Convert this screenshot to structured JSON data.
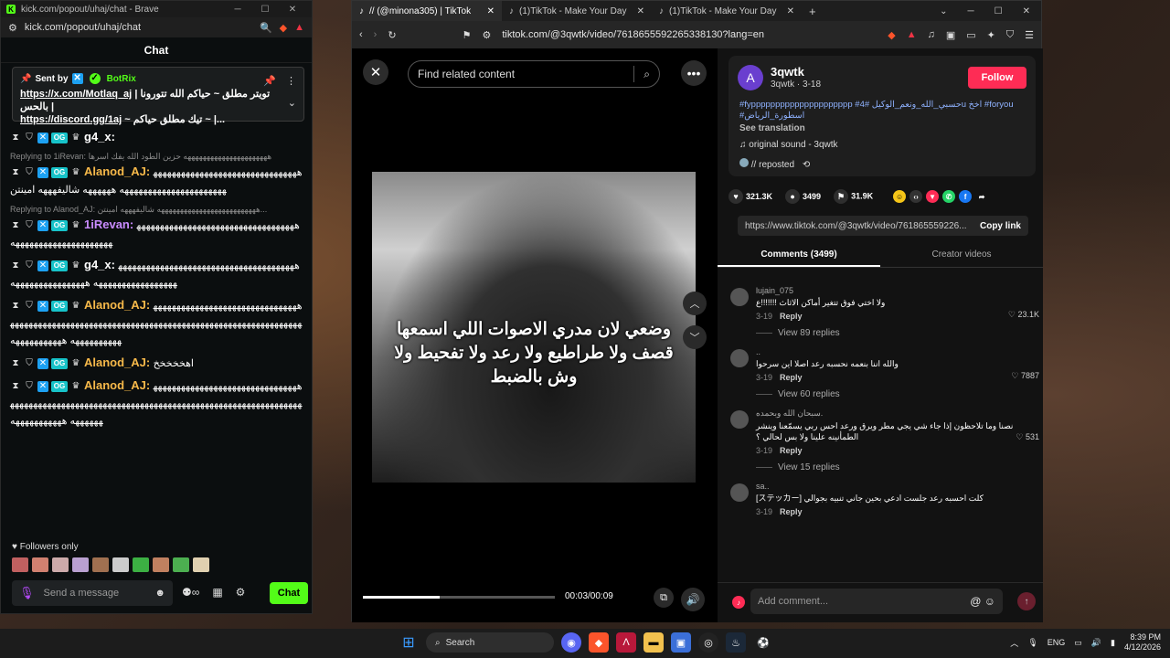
{
  "kick": {
    "window_title": "kick.com/popout/uhaj/chat - Brave",
    "url": "kick.com/popout/uhaj/chat",
    "chat_title": "Chat",
    "pinned": {
      "sent_by_label": "Sent by",
      "bot_name": "BotRix",
      "line1_link": "https://x.com/Motlaq_aj",
      "line1_text": "| تويتر مطلق ~ حياكم الله تتورونا بالحس |",
      "line2_link": "https://discord.gg/1aj",
      "line2_text": "~ تيك مطلق حياكم ~ |..."
    },
    "messages": [
      {
        "reply": "",
        "user": "g4_x:",
        "color": "#ffffff",
        "text": ""
      },
      {
        "reply": "Replying to 1iRevan: ههههههههههههههههههههههه حزين الطود الله يفك اسرها",
        "user": "Alanod_AJ:",
        "color": "#f7b94a",
        "text": "ههههههههههههههههههههههههههههههههههههههههههههههههههههههه ههههههه شاليفهههه امينتن"
      },
      {
        "reply": "Replying to Alanod_AJ: ههههههههههههههههههههههههههه شاليفهههه امينتن...",
        "user": "1iRevan:",
        "color": "#c98bff",
        "text": "ههههههههههههههههههههههههههههههههههههههههههههههههههههههههه"
      },
      {
        "reply": "",
        "user": "g4_x:",
        "color": "#ffffff",
        "text": "ههههههههههههههههههههههههههههههههههههههههههههههههههههههههه ههههههههههههههههه"
      },
      {
        "reply": "",
        "user": "Alanod_AJ:",
        "color": "#f7b94a",
        "text": "هههههههههههههههههههههههههههههههههههههههههههههههههههههههههههههههههههههههههههههههههههههههههههههههههههههههههه هههههههههههه"
      },
      {
        "reply": "",
        "user": "Alanod_AJ:",
        "color": "#f7b94a",
        "text": "اهخخخخخ"
      },
      {
        "reply": "",
        "user": "Alanod_AJ:",
        "color": "#f7b94a",
        "text": "هههههههههههههههههههههههههههههههههههههههههههههههههههههههههههههههههههههههههههههههههههههههههههههههههههههه هههههههههههه"
      }
    ],
    "followers_only": "Followers only",
    "message_placeholder": "Send a message",
    "send_label": "Chat"
  },
  "browser": {
    "tabs": [
      {
        "label": "// (@minona305) | TikTok",
        "active": true
      },
      {
        "label": "(1)TikTok - Make Your Day",
        "active": false
      },
      {
        "label": "(1)TikTok - Make Your Day",
        "active": false
      }
    ],
    "url": "tiktok.com/@3qwtk/video/7618655592265338130?lang=en"
  },
  "tiktok": {
    "search_placeholder": "Find related content",
    "caption": "وضعي لان مدري الاصوات اللي اسمعها قصف ولا طراطيع ولا رعد ولا تفحيط ولا وش بالضبط",
    "time": "00:03/00:09",
    "progress": 0.4,
    "creator": {
      "initial": "A",
      "name": "3qwtk",
      "meta": "3qwtk · 3-18",
      "follow_label": "Follow",
      "description": "#fyppppppppppppppppppppp #حسبي_الله_ونعم_الوكيل #4u اخخ #foryou #اسطورة_الرياض",
      "see_translation": "See translation",
      "sound": "original sound - 3qwtk",
      "reposted": "// reposted"
    },
    "stats": {
      "likes": "321.3K",
      "comments": "3499",
      "saves": "31.9K"
    },
    "share_link": "https://www.tiktok.com/@3qwtk/video/761865559226...",
    "copy_link": "Copy link",
    "tab_comments": "Comments (3499)",
    "tab_creator": "Creator videos",
    "comments": [
      {
        "user": "lujain_075",
        "text": "ولا اختي فوق تتغير أماكن الاثاث !!!!!!!ع",
        "date": "3-19",
        "reply": "Reply",
        "likes": "23.1K",
        "replies": "View 89 replies"
      },
      {
        "user": "..",
        "text": "والله اننا بنعمه نحسبه رعد اصلا اين سرحوا",
        "date": "3-19",
        "reply": "Reply",
        "likes": "7887",
        "replies": "View 60 replies"
      },
      {
        "user": "سبحان الله وبحمده.",
        "text": "نصنا وما تلاحظون إذا جاء شي يجي مطر ويرق ورعد احس ربي يسمّعنا وينشر الطمأنينه علينا ولا بس لحالي ؟",
        "date": "3-19",
        "reply": "Reply",
        "likes": "531",
        "replies": "View 15 replies"
      },
      {
        "user": "sa..",
        "text": "كلت احسبه رعد جلست ادعي بحين جاني تنبيه بجوالي [ステッカー]",
        "date": "3-19",
        "reply": "Reply",
        "likes": "",
        "replies": ""
      }
    ],
    "add_comment_placeholder": "Add comment..."
  },
  "taskbar": {
    "search": "Search",
    "lang": "ENG",
    "time": "8:39 PM",
    "date": "4/12/2026"
  }
}
